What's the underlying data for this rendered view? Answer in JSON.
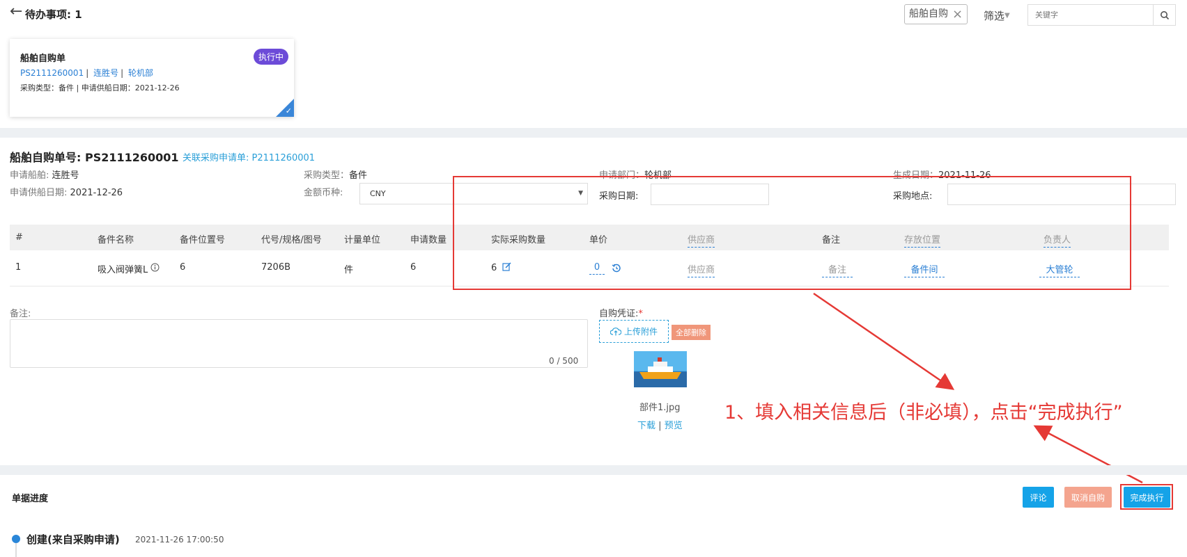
{
  "header": {
    "title": "待办事项: 1",
    "filter_tag": "船舶自购",
    "filter_label": "筛选",
    "search_placeholder": "关键字"
  },
  "card": {
    "title": "船舶自购单",
    "status": "执行中",
    "doc_no": "PS2111260001",
    "ship": "连胜号",
    "dept": "轮机部",
    "meta": "采购类型：备件 | 申请供船日期：2021-12-26"
  },
  "detail": {
    "doc_label": "船舶自购单号:",
    "doc_no": "PS2111260001",
    "link_label": "关联采购申请单:",
    "link_no": "P2111260001",
    "fields": {
      "ship_label": "申请船舶:",
      "ship": "连胜号",
      "supply_date_label": "申请供船日期:",
      "supply_date": "2021-12-26",
      "purchase_type_label": "采购类型：",
      "purchase_type": "备件",
      "currency_label": "金额币种:",
      "currency": "CNY",
      "dept_label": "申请部门：",
      "dept": "轮机部",
      "purchase_date_label": "采购日期:",
      "created_label": "生成日期：",
      "created": "2021-11-26",
      "place_label": "采购地点:"
    }
  },
  "table": {
    "headers": [
      "#",
      "备件名称",
      "备件位置号",
      "代号/规格/图号",
      "计量单位",
      "申请数量",
      "实际采购数量",
      "单价",
      "供应商",
      "备注",
      "存放位置",
      "负责人"
    ],
    "rows": [
      {
        "index": "1",
        "name": "吸入阀弹簧L",
        "position": "6",
        "code": "7206B",
        "unit": "件",
        "req_qty": "6",
        "actual_qty": "6",
        "price": "0",
        "supplier": "供应商",
        "remark": "备注",
        "storage": "备件间",
        "owner": "大管轮"
      }
    ]
  },
  "remarks": {
    "label": "备注:",
    "count": "0 / 500"
  },
  "voucher": {
    "label": "自购凭证:",
    "required": "*",
    "upload_label": "上传附件",
    "delete_all": "全部删除",
    "file_name": "部件1.jpg",
    "download": "下载",
    "separator": "|",
    "preview": "预览"
  },
  "annotation": {
    "text": "1、填入相关信息后（非必填），点击“完成执行”",
    "color": "#e53935"
  },
  "progress": {
    "title": "单据进度",
    "comment_btn": "评论",
    "cancel_btn": "取消自购",
    "finish_btn": "完成执行",
    "timeline": [
      {
        "title": "创建(来自采购申请)",
        "time": "2021-11-26 17:00:50"
      }
    ]
  }
}
